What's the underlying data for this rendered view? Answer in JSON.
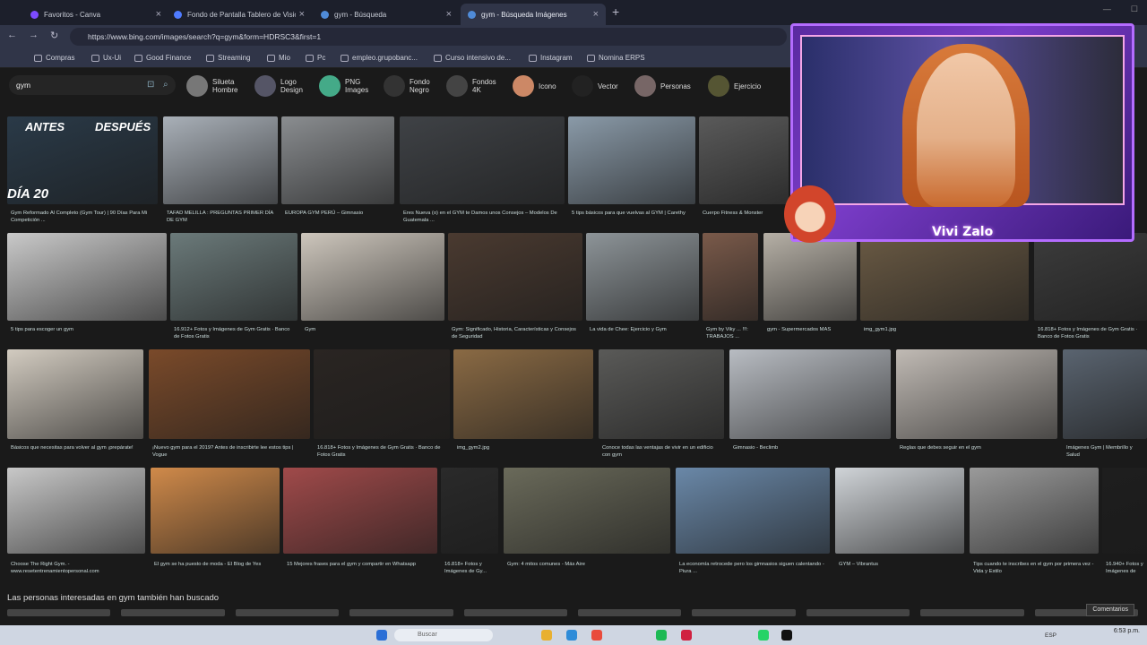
{
  "tabs": [
    {
      "title": "Favoritos - Canva",
      "color": "#7d4bff",
      "active": false
    },
    {
      "title": "Fondo de Pantalla Tablero de Visió",
      "color": "#4f7bff",
      "active": false
    },
    {
      "title": "gym - Búsqueda",
      "color": "#4f8bd8",
      "active": false
    },
    {
      "title": "gym - Búsqueda Imágenes",
      "color": "#4f8bd8",
      "active": true
    }
  ],
  "url": "https://www.bing.com/images/search?q=gym&form=HDRSC3&first=1",
  "bookmarks": [
    "Compras",
    "Ux-Ui",
    "Good Finance",
    "Streaming",
    "Mio",
    "Pc",
    "empleo.grupobanc...",
    "Curso intensivo de...",
    "Instagram",
    "Nomina ERPS"
  ],
  "search": {
    "query": "gym"
  },
  "chips": [
    {
      "label": "Silueta\nHombre",
      "color": "#777"
    },
    {
      "label": "Logo\nDesign",
      "color": "#556"
    },
    {
      "label": "PNG\nImages",
      "color": "#4a8"
    },
    {
      "label": "Fondo\nNegro",
      "color": "#333"
    },
    {
      "label": "Fondos\n4K",
      "color": "#444"
    },
    {
      "label": "Icono",
      "color": "#c86"
    },
    {
      "label": "Vector",
      "color": "#222"
    },
    {
      "label": "Personas",
      "color": "#766"
    },
    {
      "label": "Ejercicio",
      "color": "#553"
    }
  ],
  "rows": [
    [
      {
        "caption": "Gym Reformado Al Completo (Gym Tour) | 90 Días Para Mi Competición ...",
        "color": "#2a3a48"
      },
      {
        "caption": "TAFAD MELILLA : PREGUNTAS PRIMER DÍA DE GYM",
        "color": "#a9b0b8"
      },
      {
        "caption": "EUROPA GYM PERÚ – Gimnasio",
        "color": "#8a8d90"
      },
      {
        "caption": "Eres Nueva (o) en el GYM te Damos unos Consejos – Modelos De Guatemala ...",
        "color": "#3f4246"
      },
      {
        "caption": "5 tips básicos para que vuelvas al GYM | Carethy",
        "color": "#8a9aa8"
      },
      {
        "caption": "Cuerpo Fitness & Monster",
        "color": "#5a5a5a"
      }
    ],
    [
      {
        "caption": "5 tips para escoger un gym",
        "color": "#c9c9c9"
      },
      {
        "caption": "16.912+ Fotos y Imágenes de Gym Gratis · Banco de Fotos Gratis",
        "color": "#6b7a7a"
      },
      {
        "caption": "Gym",
        "color": "#cdc6bc"
      },
      {
        "caption": "Gym: Significado, Historia, Características y Consejos de Seguridad",
        "color": "#4a3a30"
      },
      {
        "caption": "La vida de Chee: Ejercicio y Gym",
        "color": "#8d9498"
      },
      {
        "caption": "Gym by Viky ... !!!: TRABAJOS ...",
        "color": "#7a5a4a"
      },
      {
        "caption": "gym - Supermercados MAS",
        "color": "#b6b0a6"
      },
      {
        "caption": "img_gym1.jpg",
        "color": "#6a5a44"
      },
      {
        "caption": "16.818+ Fotos y Imágenes de Gym Gratis · Banco de Fotos Gratis",
        "color": "#3c3c3c"
      }
    ],
    [
      {
        "caption": "Básicos que necesitas para volver al gym ¡prepárate!",
        "color": "#d2cbc0"
      },
      {
        "caption": "¡Nuevo gym para el 2019? Antes de inscribirte lee estos tips | Vogue",
        "color": "#7a4a2a"
      },
      {
        "caption": "16.818+ Fotos y Imágenes de Gym Gratis · Banco de Fotos Gratis",
        "color": "#2a2522"
      },
      {
        "caption": "img_gym2.jpg",
        "color": "#8a6a44"
      },
      {
        "caption": "Conoce todas las ventajas de vivir en un edificio con gym",
        "color": "#5a5a58"
      },
      {
        "caption": "Gimnasio - Beclimb",
        "color": "#b8bcc2"
      },
      {
        "caption": "Reglas que debes seguir en el gym",
        "color": "#c0bab4"
      },
      {
        "caption": "Imágenes Gym | Membrillo y Salud",
        "color": "#5a6470"
      }
    ],
    [
      {
        "caption": "Choose The Right Gym. - www.resetentrenamientopersonal.com",
        "color": "#c8c8c8"
      },
      {
        "caption": "El gym se ha puesto de moda - El Blog de Yes",
        "color": "#d08a4a"
      },
      {
        "caption": "15 Mejores frases para el gym y compartir en Whatsapp",
        "color": "#a04a4a"
      },
      {
        "caption": "16.818+ Fotos y Imágenes de Gy...",
        "color": "#2a2a2a"
      },
      {
        "caption": "Gym: 4 mitos comunes - Más Aire",
        "color": "#6a6a5a"
      },
      {
        "caption": "La economía retrocede pero los gimnasios siguen calentando - Piura ...",
        "color": "#6a88a8"
      },
      {
        "caption": "GYM – Vibrantus",
        "color": "#d0d4d8"
      },
      {
        "caption": "Tips cuando te inscribes en el gym por primera vez - Vida y Estilo",
        "color": "#9a9a9a"
      },
      {
        "caption": "16.940+ Fotos y Imágenes de G...",
        "color": "#1e1e1e"
      }
    ]
  ],
  "tile_overlays": {
    "before": "ANTES",
    "after": "DESPUÉS",
    "day": "DÍA 20"
  },
  "streamer_name": "Vivi Zalo",
  "related_title": "Las personas interesadas en gym también han buscado",
  "feedback": "Comentarios",
  "taskbar": {
    "search": "Buscar",
    "lang": "ESP",
    "time": "6:53 p.m."
  }
}
